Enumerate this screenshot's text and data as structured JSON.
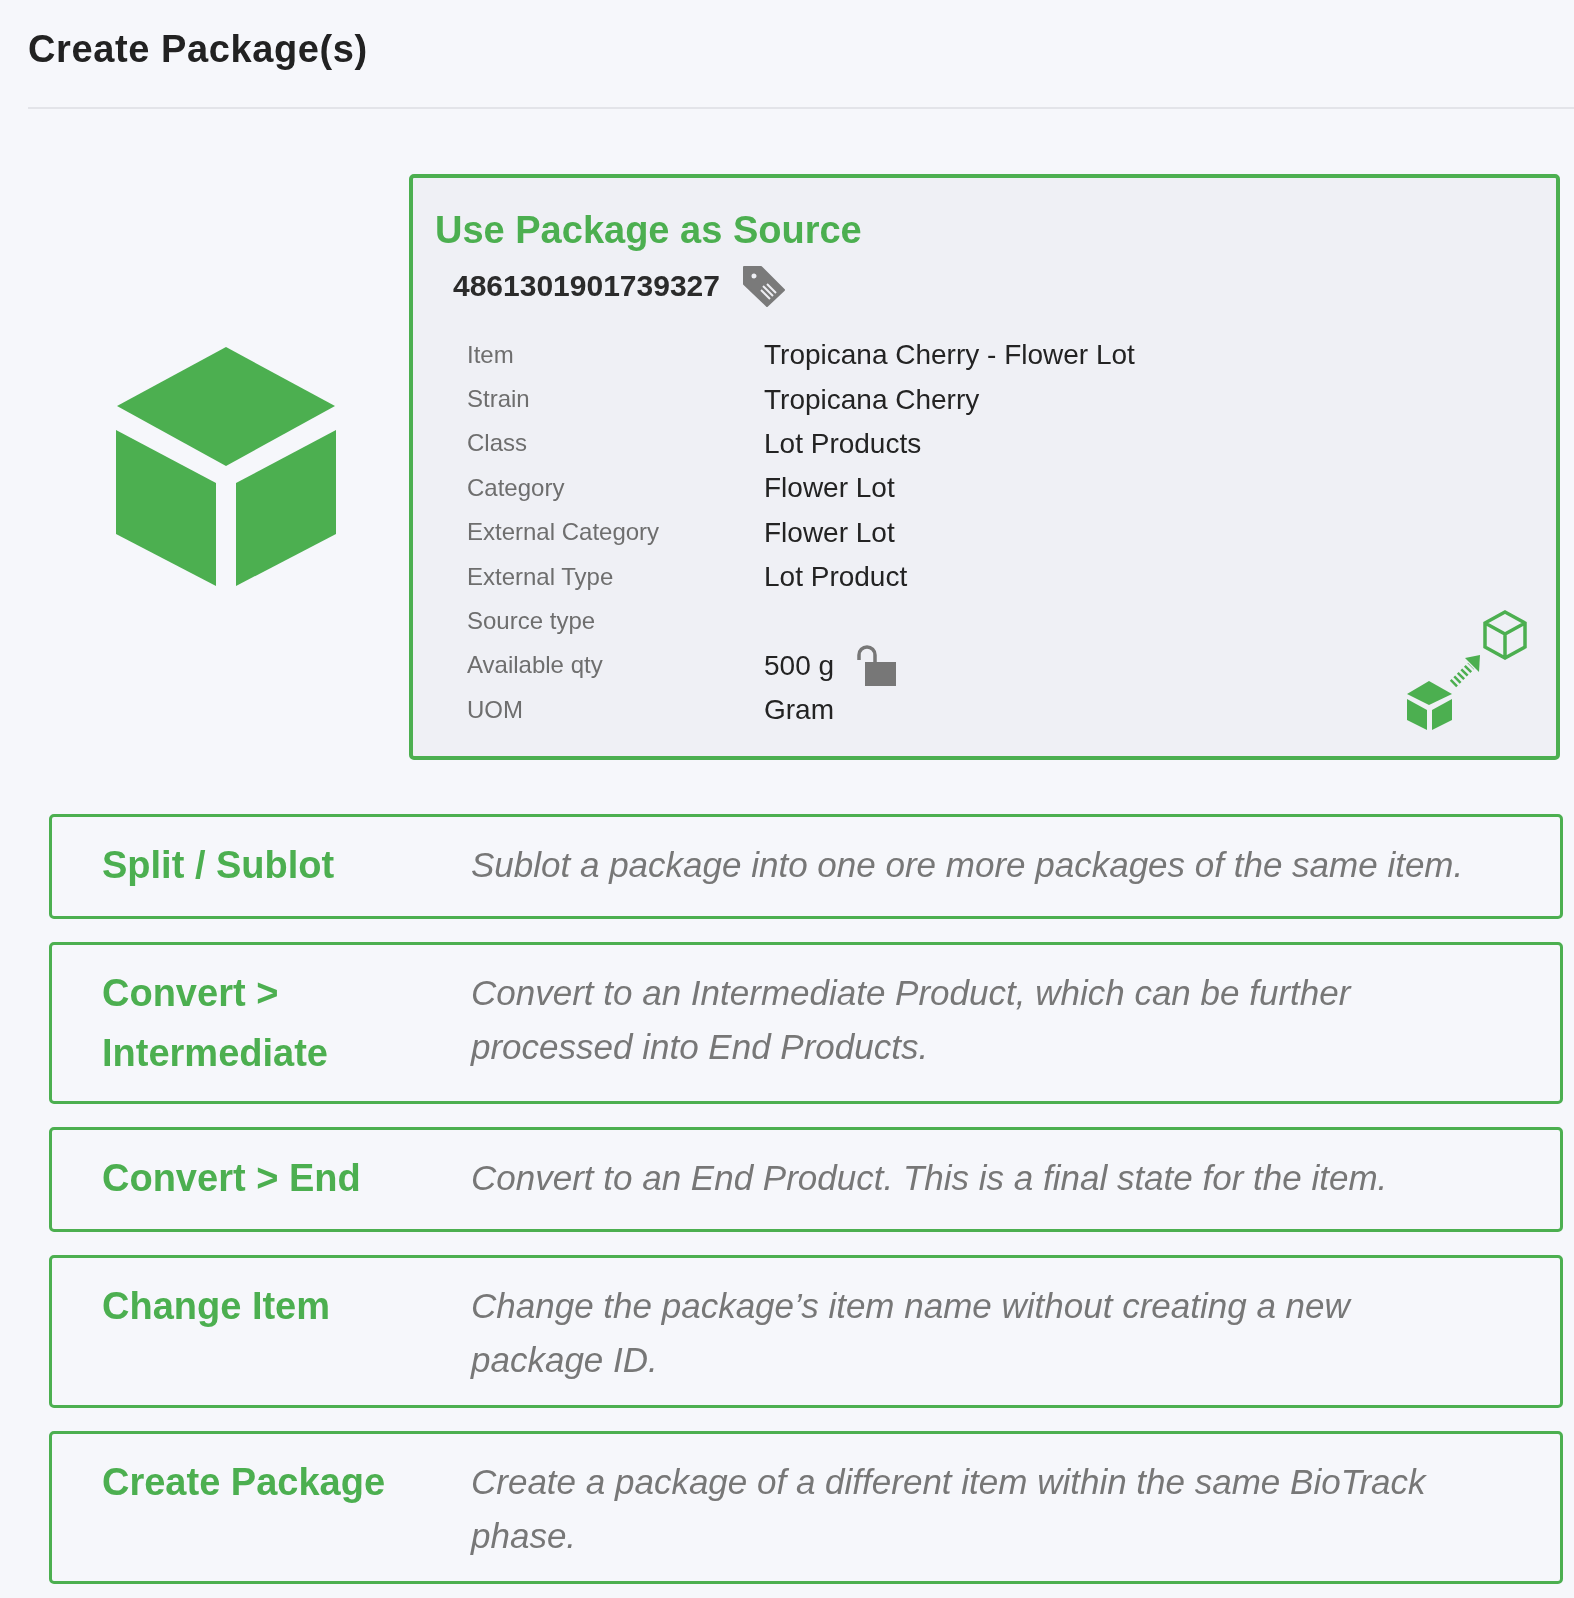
{
  "page": {
    "title": "Create Package(s)"
  },
  "source_package": {
    "title": "Use Package as Source",
    "package_id": "4861301901739327",
    "details": [
      {
        "label": "Item",
        "value": "Tropicana Cherry - Flower Lot"
      },
      {
        "label": "Strain",
        "value": "Tropicana Cherry"
      },
      {
        "label": "Class",
        "value": "Lot Products"
      },
      {
        "label": "Category",
        "value": "Flower Lot"
      },
      {
        "label": "External Category",
        "value": "Flower Lot"
      },
      {
        "label": "External Type",
        "value": "Lot Product"
      },
      {
        "label": "Source type"
      },
      {
        "label": "Available qty",
        "value": "500 g",
        "locked": false
      },
      {
        "label": "UOM",
        "value": "Gram"
      }
    ]
  },
  "options": [
    {
      "title": "Split / Sublot",
      "description": "Sublot a package into one ore more packages of the same item."
    },
    {
      "title": "Convert > Intermediate",
      "description": "Convert to an Intermediate Product, which can be further processed into End Products."
    },
    {
      "title": "Convert > End",
      "description": "Convert to an End Product. This is a final state for the item."
    },
    {
      "title": "Change Item",
      "description": "Change the package’s item name without creating a new package ID."
    },
    {
      "title": "Create Package",
      "description": "Create a package of a different item within the same BioTrack phase."
    }
  ]
}
